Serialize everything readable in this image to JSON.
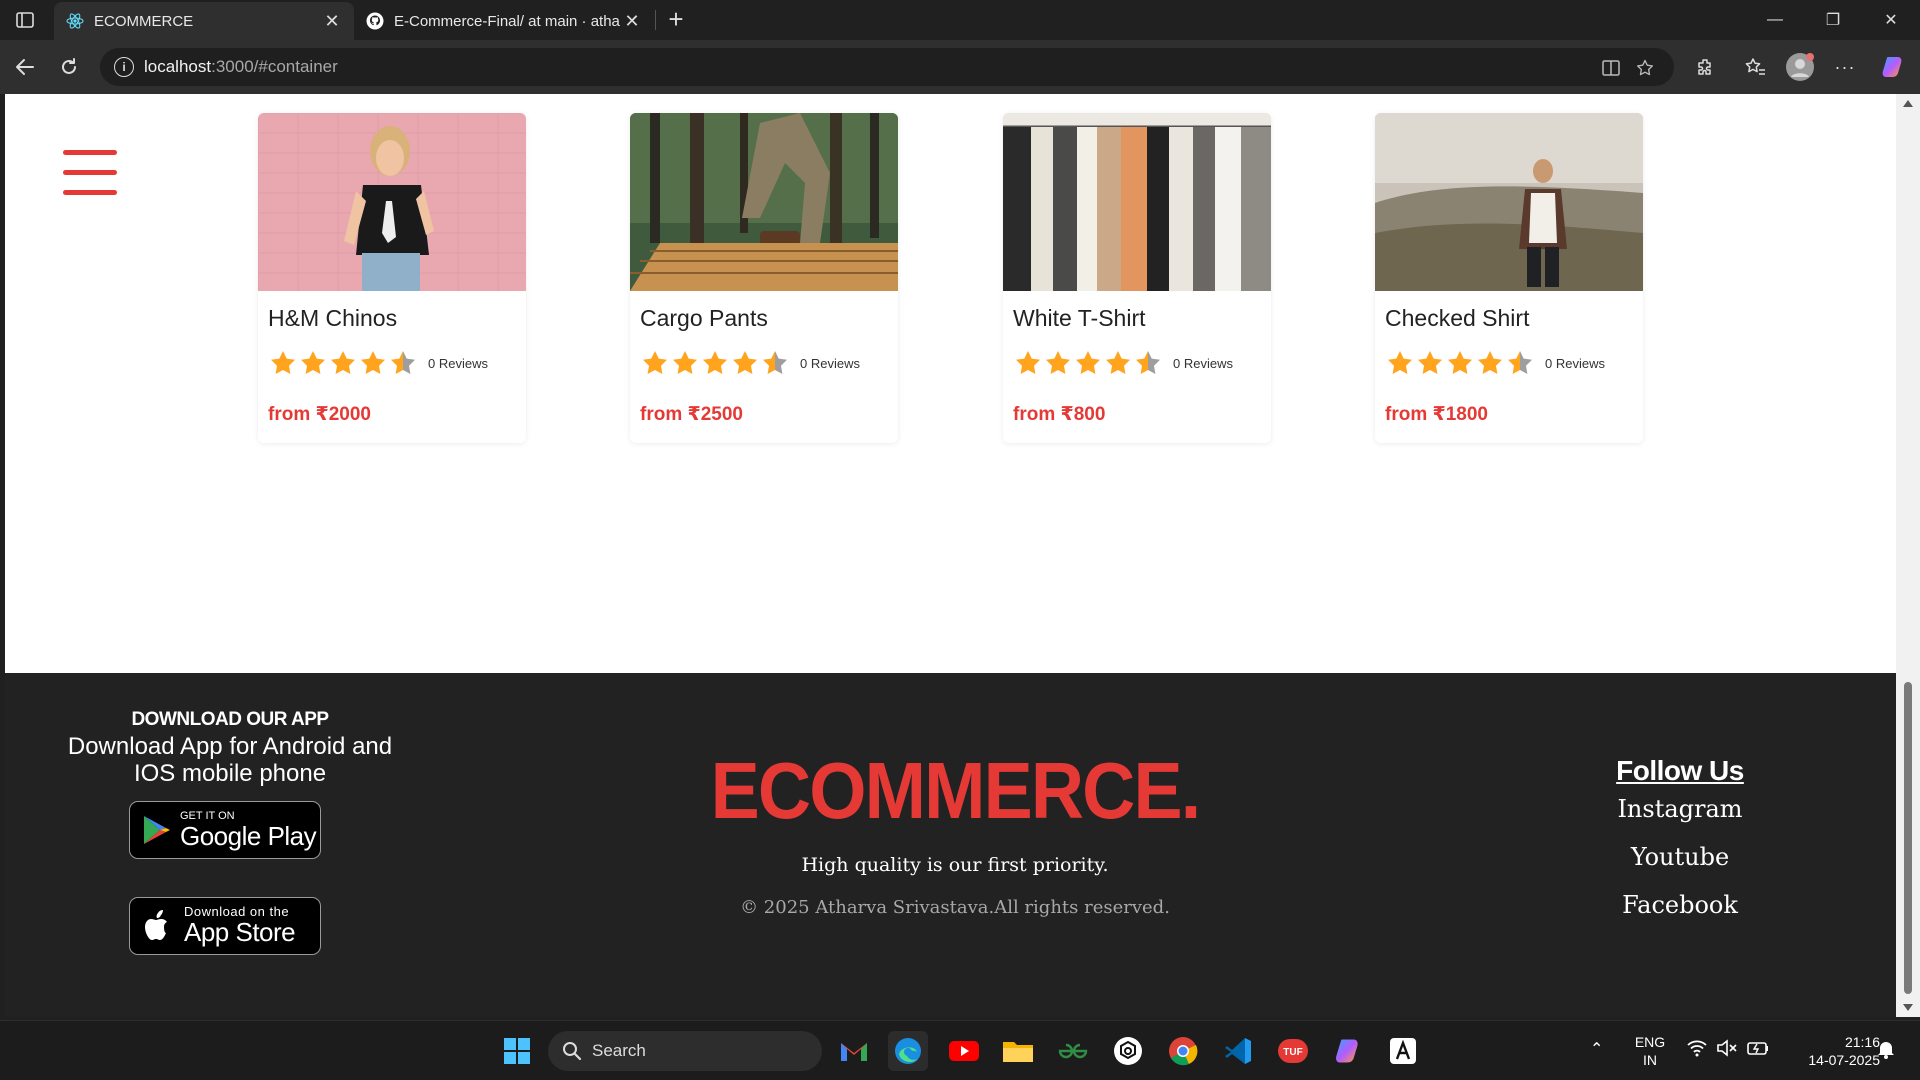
{
  "browser": {
    "tabs": [
      {
        "title": "ECOMMERCE",
        "active": true
      },
      {
        "title": "E-Commerce-Final/ at main · atha",
        "active": false
      }
    ],
    "new_tab": "+",
    "url_host": "localhost",
    "url_path": ":3000/#container",
    "close_glyph": "✕",
    "window_controls": {
      "minimize": "—",
      "restore": "❐",
      "close": "✕"
    },
    "more_glyph": "···"
  },
  "products": [
    {
      "name": "H&M Chinos",
      "rating": 4.5,
      "reviews": "0 Reviews",
      "price": "from ₹2000"
    },
    {
      "name": "Cargo Pants",
      "rating": 4.5,
      "reviews": "0 Reviews",
      "price": "from ₹2500"
    },
    {
      "name": "White T-Shirt",
      "rating": 4.5,
      "reviews": "0 Reviews",
      "price": "from ₹800"
    },
    {
      "name": "Checked Shirt",
      "rating": 4.5,
      "reviews": "0 Reviews",
      "price": "from ₹1800"
    }
  ],
  "footer": {
    "download_heading": "DOWNLOAD OUR APP",
    "download_sub": "Download App for Android and IOS mobile phone",
    "google_play": {
      "small": "GET IT ON",
      "big": "Google Play"
    },
    "app_store": {
      "small": "Download on the",
      "big": "App Store"
    },
    "brand": "ECOMMERCE.",
    "tagline": "High quality is our first priority.",
    "copyright": "© 2025 Atharva Srivastava.All rights reserved.",
    "follow_title": "Follow Us",
    "social_links": [
      "Instagram",
      "Youtube",
      "Facebook"
    ]
  },
  "taskbar": {
    "search_placeholder": "Search",
    "lang_top": "ENG",
    "lang_bottom": "IN",
    "time": "21:16",
    "date": "14-07-2025"
  },
  "colors": {
    "accent_red": "#e53935",
    "star_gold": "#ffa41c",
    "footer_bg": "#222222"
  },
  "icons": [
    "sidebar-toggle-icon",
    "react-icon",
    "github-icon",
    "back-icon",
    "reload-icon",
    "info-icon",
    "split-screen-icon",
    "star-favorite-icon",
    "extensions-icon",
    "favorites-icon",
    "profile-icon",
    "more-icon",
    "copilot-icon",
    "hamburger-menu-icon",
    "star-icon",
    "google-play-icon",
    "apple-icon",
    "windows-start-icon",
    "search-icon"
  ]
}
